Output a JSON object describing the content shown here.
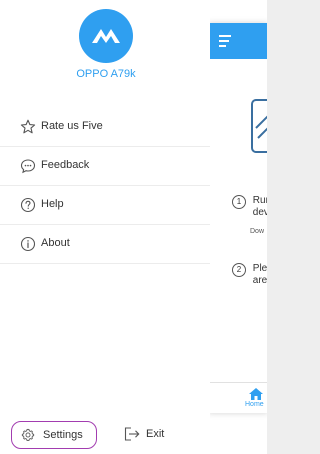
{
  "drawer": {
    "device_name": "OPPO A79k",
    "menu": [
      {
        "label": "Rate us Five",
        "icon": "star-icon"
      },
      {
        "label": "Feedback",
        "icon": "chat-bubble-icon"
      },
      {
        "label": "Help",
        "icon": "help-circle-icon"
      },
      {
        "label": "About",
        "icon": "info-circle-icon"
      }
    ],
    "footer": {
      "settings_label": "Settings",
      "exit_label": "Exit"
    }
  },
  "background_app": {
    "steps": [
      {
        "num": "1",
        "text": "Run",
        "text2": "dev",
        "sub": "Dow"
      },
      {
        "num": "2",
        "text": "Plea",
        "text2": "are("
      }
    ],
    "bottom_nav": {
      "home_label": "Home"
    }
  },
  "colors": {
    "accent": "#2f9ff0",
    "highlight_border": "#a23cb0",
    "text": "#333333"
  }
}
